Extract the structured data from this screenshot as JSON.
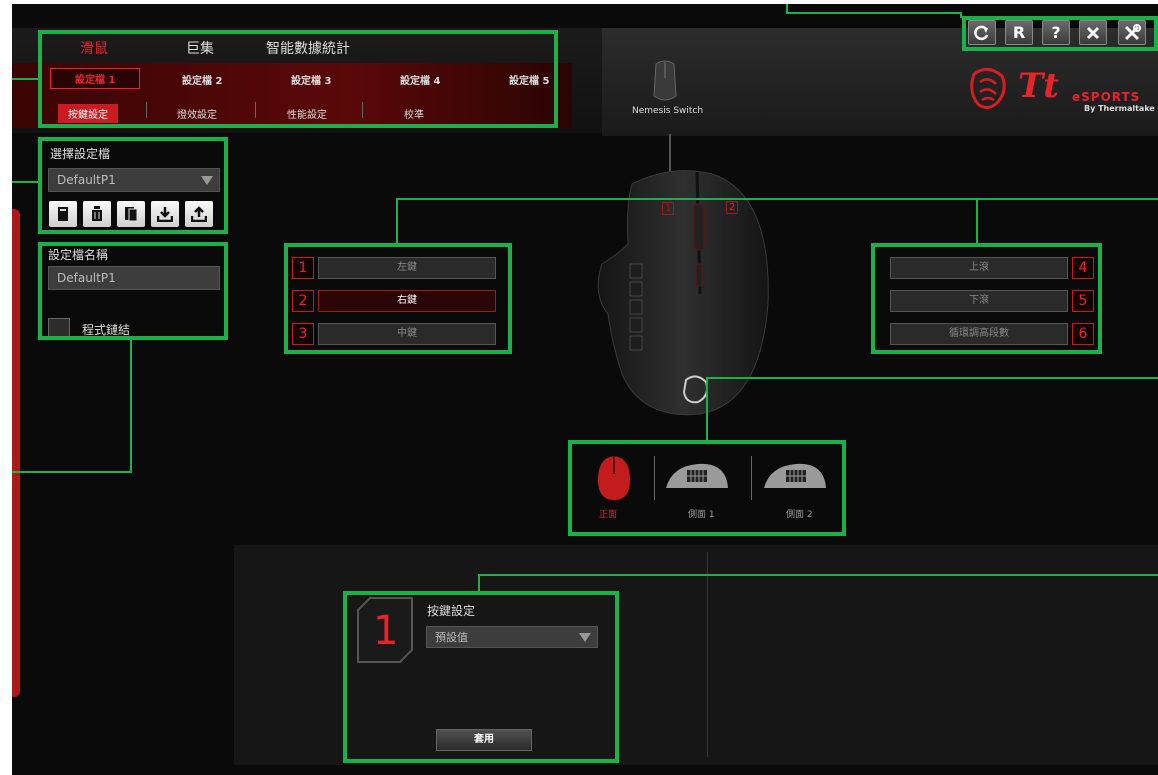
{
  "main_tabs": [
    "滑鼠",
    "巨集",
    "智能數據統計"
  ],
  "profile_tabs": [
    "設定檔 1",
    "設定檔 2",
    "設定檔 3",
    "設定檔 4",
    "設定檔 5"
  ],
  "sub_tabs": [
    "按鍵設定",
    "燈效設定",
    "性能設定",
    "校準"
  ],
  "toolbar_buttons": [
    "refresh-icon",
    "R",
    "?",
    "close-icon",
    "tools-icon"
  ],
  "product_name": "Nemesis Switch",
  "brand": {
    "tt": "Tt",
    "esports": "eSPORTS",
    "by": "By Thermaltake"
  },
  "select_profile": {
    "label": "選擇設定檔",
    "value": "DefaultP1"
  },
  "profile_name": {
    "label": "設定檔名稱",
    "value": "DefaultP1"
  },
  "program_link": {
    "label": "程式鏈結",
    "checked": false
  },
  "left_buttons": [
    {
      "num": "1",
      "label": "左鍵"
    },
    {
      "num": "2",
      "label": "右鍵"
    },
    {
      "num": "3",
      "label": "中鍵"
    }
  ],
  "right_buttons": [
    {
      "num": "4",
      "label": "上滾"
    },
    {
      "num": "5",
      "label": "下滾"
    },
    {
      "num": "6",
      "label": "循環調高段數"
    }
  ],
  "mouse_labels": [
    "1",
    "2"
  ],
  "views": [
    "正面",
    "側面 1",
    "側面 2"
  ],
  "editor": {
    "number": "1",
    "title": "按鍵設定",
    "dropdown": "預設值",
    "apply": "套用"
  },
  "colors": {
    "accent_red": "#e8232a",
    "highlight_green": "#1cb04a"
  }
}
